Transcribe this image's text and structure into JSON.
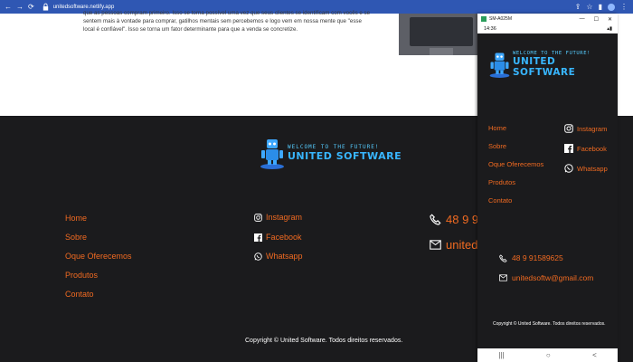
{
  "browser": {
    "url": "unitedsoftware.netlify.app",
    "nav_back": "←",
    "nav_forward": "→",
    "nav_reload": "⟳"
  },
  "page": {
    "paragraph": "que as pessoas compram primeiro. Isso se torna possível uma vez que seus clientes se identificam com vocês e se sentem mais à vontade para comprar, gatilhos mentais sem percebemos e logo vem em nossa mente que \"esse local é confiável\". Isso se torna um fator determinante para que a venda se concretize."
  },
  "footer": {
    "logo": {
      "welcome": "WELCOME TO THE FUTURE!",
      "brand": "UNITED SOFTWARE"
    },
    "links": [
      "Home",
      "Sobre",
      "Oque Oferecemos",
      "Produtos",
      "Contato"
    ],
    "social": [
      {
        "label": "Instagram",
        "icon": "instagram-icon"
      },
      {
        "label": "Facebook",
        "icon": "facebook-icon"
      },
      {
        "label": "Whatsapp",
        "icon": "whatsapp-icon"
      }
    ],
    "phone_partial": "48 9 9",
    "email_partial": "united",
    "copyright": "Copyright © United Software. Todos direitos reservados."
  },
  "phone_window": {
    "title": "SM-A025M",
    "status_time": "14:36",
    "logo": {
      "welcome": "WELCOME TO THE FUTURE!",
      "brand": "UNITED SOFTWARE"
    },
    "links": [
      "Home",
      "Sobre",
      "Oque Oferecemos",
      "Produtos",
      "Contato"
    ],
    "social": [
      "Instagram",
      "Facebook",
      "Whatsapp"
    ],
    "phone": "48 9 91589625",
    "email": "unitedsoftw@gmail.com",
    "copyright": "Copyright © United Software. Todos direitos reservados.",
    "nav": [
      "|||",
      "○",
      "<"
    ]
  },
  "colors": {
    "accent": "#f06a21",
    "brand": "#38b6ff",
    "bg": "#1b1b1d",
    "chrome": "#2f57b3"
  }
}
